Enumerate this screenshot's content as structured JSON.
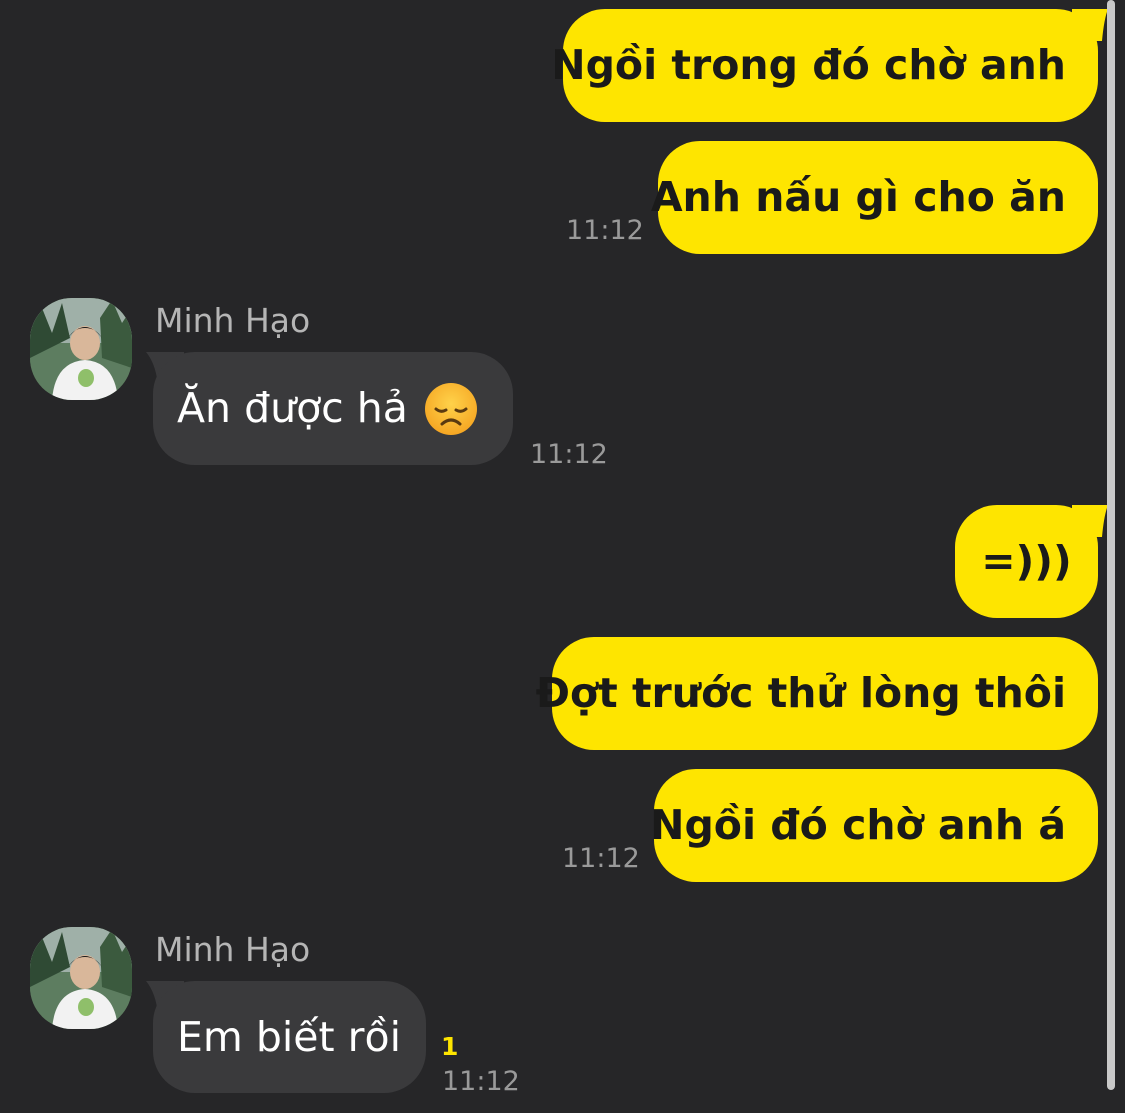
{
  "conversation": {
    "messages": [
      {
        "id": "m1",
        "side": "outgoing",
        "text": "Ngồi trong đó chờ anh"
      },
      {
        "id": "m2",
        "side": "outgoing",
        "text": "Anh nấu gì cho ăn",
        "time": "11:12"
      },
      {
        "id": "m3",
        "side": "incoming",
        "sender": "Minh Hạo",
        "text": "Ăn được hả",
        "emoji": "disappointed-face-emoji",
        "time": "11:12"
      },
      {
        "id": "m4",
        "side": "outgoing",
        "text": "=)))"
      },
      {
        "id": "m5",
        "side": "outgoing",
        "text": "Đợt trước thử lòng thôi"
      },
      {
        "id": "m6",
        "side": "outgoing",
        "text": "Ngồi đó chờ anh á",
        "time": "11:12"
      },
      {
        "id": "m7",
        "side": "incoming",
        "sender": "Minh Hạo",
        "text": "Em biết rồi",
        "time": "11:12",
        "unread_count": "1"
      }
    ]
  },
  "colors": {
    "background": "#262628",
    "outgoing_bubble": "#FEE500",
    "incoming_bubble": "#3a3a3c",
    "unread_count": "#FEE500"
  },
  "icons": {
    "avatar": "avatar-photo",
    "emoji": "disappointed-face-emoji"
  }
}
